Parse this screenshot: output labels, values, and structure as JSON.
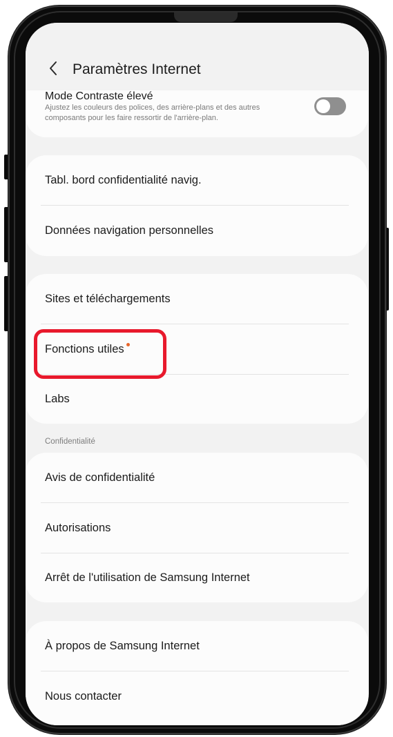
{
  "header": {
    "title": "Paramètres Internet"
  },
  "contrast": {
    "title": "Mode Contraste élevé",
    "description": "Ajustez les couleurs des polices, des arrière-plans et des autres composants pour les faire ressortir de l'arrière-plan.",
    "enabled": false
  },
  "group1": {
    "items": [
      "Tabl. bord confidentialité navig.",
      "Données navigation personnelles"
    ]
  },
  "group2": {
    "items": [
      "Sites et téléchargements",
      "Fonctions utiles",
      "Labs"
    ]
  },
  "privacy": {
    "section_label": "Confidentialité",
    "items": [
      "Avis de confidentialité",
      "Autorisations",
      "Arrêt de l'utilisation de Samsung Internet"
    ]
  },
  "group4": {
    "items": [
      "À propos de Samsung Internet",
      "Nous contacter"
    ]
  },
  "colors": {
    "highlight": "#e8192c",
    "new_badge": "#e8662b"
  }
}
